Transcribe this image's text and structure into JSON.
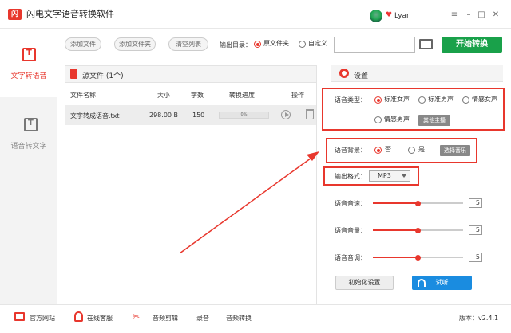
{
  "app": {
    "title": "闪电文字语音转换软件",
    "logo_text": "闪",
    "user": "Lyan",
    "win_buttons": [
      "≡",
      "–",
      "□",
      "✕"
    ]
  },
  "sidebar": {
    "items": [
      {
        "label": "文字转语音",
        "icon": "text-to-speech-icon",
        "active": true
      },
      {
        "label": "语音转文字",
        "icon": "speech-to-text-icon",
        "active": false
      }
    ]
  },
  "toolbar": {
    "add_file": "添加文件",
    "add_folder": "添加文件夹",
    "clear_list": "清空列表",
    "output_label": "输出目录：",
    "output_options": [
      "原文件夹",
      "自定义"
    ],
    "output_selected": 0,
    "path_value": "",
    "start": "开始转换"
  },
  "file_panel": {
    "title": "源文件 (1个)",
    "columns": [
      "文件名称",
      "大小",
      "字数",
      "转换进度",
      "操作"
    ],
    "rows": [
      {
        "name": "文字转成语音.txt",
        "size": "298.00 B",
        "words": "150",
        "progress": "0%",
        "progress_value": 0
      }
    ]
  },
  "settings": {
    "title": "设置",
    "voice_type_label": "语音类型：",
    "voice_options": [
      "标准女声",
      "标准男声",
      "情感女声",
      "情感男声"
    ],
    "voice_selected": 0,
    "other_voices": "其他主播",
    "bg_label": "语音背景：",
    "bg_options": [
      "否",
      "是"
    ],
    "bg_selected": 0,
    "choose_music": "选择音乐",
    "format_label": "输出格式：",
    "format_value": "MP3",
    "speed_label": "语音音速：",
    "speed_value": "5",
    "volume_label": "语音音量：",
    "volume_value": "5",
    "pitch_label": "语音音调：",
    "pitch_value": "5",
    "reset": "初始化设置",
    "listen": "试听"
  },
  "footer": {
    "website": "官方网站",
    "support": "在线客服",
    "audio_edit": "音频剪辑",
    "record": "录音",
    "audio_convert": "音频转换",
    "version": "版本：v2.4.1"
  },
  "colors": {
    "accent": "#e8372d",
    "start": "#19a14a",
    "listen": "#1a8ce0"
  }
}
